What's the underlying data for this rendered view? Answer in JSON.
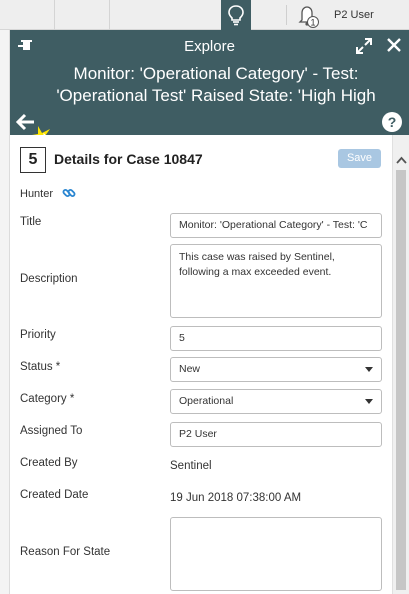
{
  "topbar": {
    "user_label": "P2 User",
    "notification_count": "1"
  },
  "panel": {
    "title": "Explore",
    "headline_line1": "Monitor: 'Operational Category' - Test:",
    "headline_line2": "'Operational Test' Raised State: 'High High",
    "help_label": "?"
  },
  "case": {
    "number": "5",
    "title": "Details for Case 10847",
    "save_label": "Save",
    "hunter_label": "Hunter"
  },
  "form": {
    "title_label": "Title",
    "title_value": "Monitor: 'Operational Category' - Test: 'C",
    "description_label": "Description",
    "description_value": "This case was raised by Sentinel, following a max exceeded event.",
    "priority_label": "Priority",
    "priority_value": "5",
    "status_label": "Status *",
    "status_value": "New",
    "category_label": "Category *",
    "category_value": "Operational",
    "assigned_label": "Assigned To",
    "assigned_value": "P2 User",
    "created_by_label": "Created By",
    "created_by_value": "Sentinel",
    "created_date_label": "Created Date",
    "created_date_value": "19 Jun 2018 07:38:00 AM",
    "reason_label": "Reason For State",
    "reason_value": ""
  },
  "icons": {
    "topbar": [
      "lightbulb-icon",
      "bell-icon"
    ],
    "panel": [
      "pin-icon",
      "expand-icon",
      "close-icon",
      "back-arrow-icon",
      "help-icon"
    ],
    "form": [
      "link-icon",
      "chevron-down-icon"
    ]
  },
  "colors": {
    "header_bg": "#3f5d63",
    "save_button": "#a9c7e2",
    "link_icon": "#2a86d1"
  }
}
